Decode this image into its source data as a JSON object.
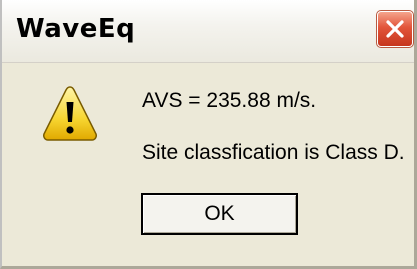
{
  "window": {
    "title": "WaveEq",
    "close_icon": "close-icon"
  },
  "message": {
    "icon": "warning-icon",
    "line1": "AVS = 235.88 m/s.",
    "line2": "Site classfication is Class D."
  },
  "buttons": {
    "ok_label": "OK"
  },
  "colors": {
    "dialog_background": "#ece9d8",
    "close_button": "#e2553a",
    "warning_yellow": "#f7d631"
  }
}
